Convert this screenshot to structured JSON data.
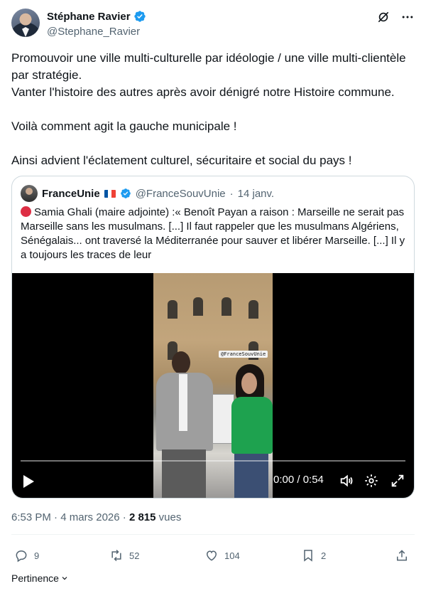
{
  "author": {
    "display_name": "Stéphane Ravier",
    "handle": "@Stephane_Ravier"
  },
  "header_icons": [
    "grok-icon",
    "more-icon"
  ],
  "tweet": {
    "text": "Promouvoir une ville multi-culturelle par idéologie / une ville multi-clientèle par stratégie.\nVanter l'histoire des autres après avoir dénigré notre Histoire commune.\n\nVoilà comment agit la gauche municipale !\n\nAinsi advient l'éclatement culturel, sécuritaire et social du pays !"
  },
  "quote": {
    "display_name": "FranceUnie",
    "handle": "@FranceSouvUnie",
    "separator": "·",
    "date": "14 janv.",
    "text": "Samia Ghali (maire adjointe) :« Benoît Payan a raison : Marseille ne serait pas Marseille sans les musulmans. [...] Il faut rappeler que les musulmans Algériens, Sénégalais... ont traversé la Méditerranée pour sauver et libérer Marseille. [...]  Il y a toujours les traces de leur",
    "video": {
      "watermark": "@FranceSouvUnie",
      "time": "0:00 / 0:54",
      "progress": 0
    }
  },
  "meta": {
    "time": "6:53 PM",
    "separator": " · ",
    "date": "4 mars 2026",
    "views_count": "2 815",
    "views_label": " vues"
  },
  "actions": {
    "replies": "9",
    "reposts": "52",
    "likes": "104",
    "bookmarks": "2"
  },
  "sort": {
    "label": "Pertinence"
  },
  "colors": {
    "verified": "#1d9bf0",
    "secondary_text": "#536471",
    "border": "#cfd9de"
  }
}
